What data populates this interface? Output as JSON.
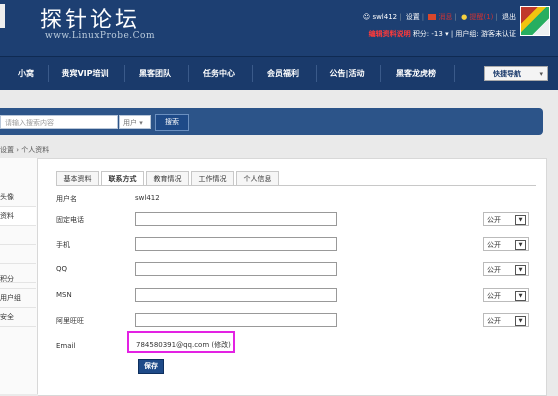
{
  "site": {
    "logo_cn": "探针论坛",
    "logo_en": "www.LinuxProbe.Com"
  },
  "user": {
    "name": "swl412",
    "settings": "设置",
    "messages": "消息",
    "reminders": "提醒(1)",
    "logout": "退出",
    "warning": "编辑资料说明",
    "points": "积分: -13",
    "group": "用户组: 游客未认证"
  },
  "nav": [
    "小窝",
    "贵宾VIP培训",
    "黑客团队",
    "任务中心",
    "会员福利",
    "公告|活动",
    "黑客龙虎榜"
  ],
  "quick_nav": "快捷导航",
  "search": {
    "placeholder": "请输入搜索内容",
    "type": "用户",
    "button": "搜索"
  },
  "breadcrumb": "设置 › 个人资料",
  "sidebar": [
    "头像",
    "资料",
    "",
    "",
    "",
    "积分",
    "用户组",
    "安全"
  ],
  "tabs": [
    "基本资料",
    "联系方式",
    "教育情况",
    "工作情况",
    "个人信息"
  ],
  "active_tab": "联系方式",
  "form": {
    "username_label": "用户名",
    "username_value": "swl412",
    "fields": [
      {
        "label": "固定电话",
        "privacy": "公开"
      },
      {
        "label": "手机",
        "privacy": "公开"
      },
      {
        "label": "QQ",
        "privacy": "公开"
      },
      {
        "label": "MSN",
        "privacy": "公开"
      },
      {
        "label": "阿里旺旺",
        "privacy": "公开"
      }
    ],
    "email_label": "Email",
    "email_value": "784580391@qq.com (修改)",
    "save": "保存"
  }
}
